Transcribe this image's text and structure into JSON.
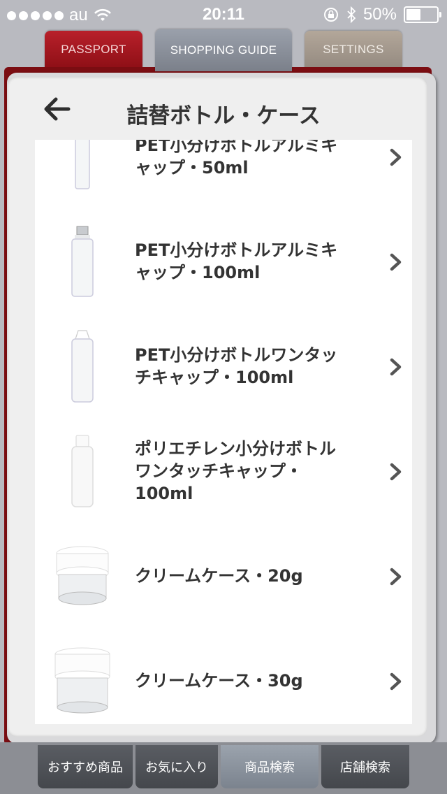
{
  "status_bar": {
    "carrier": "au",
    "time": "20:11",
    "battery_percent": "50%",
    "battery_level": 0.5
  },
  "top_tabs": {
    "passport": "PASSPORT",
    "shopping_guide": "SHOPPING GUIDE",
    "settings": "SETTINGS",
    "active": "shopping_guide"
  },
  "header": {
    "title": "詰替ボトル・ケース",
    "back_icon": "arrow-left-icon"
  },
  "products": [
    {
      "line1": "PET小分けボトルアルミキ",
      "line2": "ャップ・50ml",
      "line3": "",
      "thumb": "pet-bottle-aluminum-cap"
    },
    {
      "line1": "PET小分けボトルアルミキ",
      "line2": "ャップ・100ml",
      "line3": "",
      "thumb": "pet-bottle-aluminum-cap"
    },
    {
      "line1": "PET小分けボトルワンタッ",
      "line2": "チキャップ・100ml",
      "line3": "",
      "thumb": "pet-bottle-flip-cap"
    },
    {
      "line1": "ポリエチレン小分けボトル",
      "line2": "ワンタッチキャップ・",
      "line3": "100ml",
      "thumb": "pe-bottle-flip-cap"
    },
    {
      "line1": "クリームケース・20g",
      "line2": "",
      "line3": "",
      "thumb": "cream-jar"
    },
    {
      "line1": "クリームケース・30g",
      "line2": "",
      "line3": "",
      "thumb": "cream-jar"
    }
  ],
  "bottom_tabs": {
    "recommended": "おすすめ商品",
    "favorites": "お気に入り",
    "product_search": "商品検索",
    "store_search": "店舗検索",
    "active": "product_search"
  },
  "colors": {
    "passport_tab": "#8e0f16",
    "active_tab": "#7b808a",
    "book_cover": "#7b0d12"
  }
}
